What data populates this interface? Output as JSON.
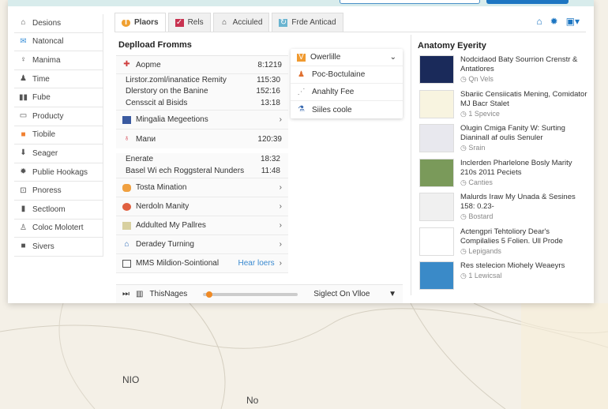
{
  "sidebar": {
    "items": [
      {
        "label": "Desions",
        "icon": "building-icon"
      },
      {
        "label": "Natoncal",
        "icon": "mail-icon"
      },
      {
        "label": "Manima",
        "icon": "bulb-icon"
      },
      {
        "label": "Time",
        "icon": "user-icon"
      },
      {
        "label": "Fube",
        "icon": "columns-icon"
      },
      {
        "label": "Producty",
        "icon": "monitor-icon"
      },
      {
        "label": "Tiobile",
        "icon": "folder-icon"
      },
      {
        "label": "Seager",
        "icon": "download-icon"
      },
      {
        "label": "Publie Hookags",
        "icon": "gear-icon"
      },
      {
        "label": "Pnoress",
        "icon": "terminal-icon"
      },
      {
        "label": "Sectloom",
        "icon": "book-icon"
      },
      {
        "label": "Coloc Molotert",
        "icon": "flask-icon"
      },
      {
        "label": "Sivers",
        "icon": "briefcase-icon"
      }
    ]
  },
  "tabs": [
    {
      "label": "Plaors",
      "active": true
    },
    {
      "label": "Rels"
    },
    {
      "label": "Acciuled"
    },
    {
      "label": "Frde Anticad"
    }
  ],
  "header_icons": [
    "home-icon",
    "gear-icon",
    "user-dropdown-icon"
  ],
  "main": {
    "title": "Deplload Fromms",
    "group1": {
      "label": "Aopme",
      "value": "8:1219",
      "subs": [
        {
          "label": "Lirstor.zoml/inanatice Remity",
          "value": "115:30"
        },
        {
          "label": "Dlerstory on the Banine",
          "value": "152:16"
        },
        {
          "label": "Censscit al Bisids",
          "value": "13:18"
        }
      ]
    },
    "row2": "Mingalia Megeetions",
    "group2": {
      "label": "Manи",
      "value": "120:39",
      "subs": [
        {
          "label": "Enerate",
          "value": "18:32"
        },
        {
          "label": "Basel Wi ech Roggsteral Nunders",
          "value": "11:48"
        }
      ]
    },
    "rows": [
      "Tosta Mination",
      "Nerdoln Manity",
      "Addulted My Pallres",
      "Deradey Turning"
    ],
    "last": {
      "label": "MMS Mildion-Sointional",
      "link": "Hear loers"
    }
  },
  "dropdown": {
    "selected": "Owerlille",
    "items": [
      "Poc-Boctulaine",
      "Anahlty Fee",
      "Siiles coole"
    ]
  },
  "right": {
    "title": "Anatomy Eyerity",
    "items": [
      {
        "title": "Nodcidaod Baty Sourrion Crenstr & Antatlores",
        "meta": "Qn Vels"
      },
      {
        "title": "Sbariic Censiicatis Mening, Comidator MJ Bacr Stalet",
        "meta": "1 Spevice"
      },
      {
        "title": "Olugin Cmiga Fanity W: Surting Dianinall af oulis Senuler",
        "meta": "Srain"
      },
      {
        "title": "Inclerden Pharlelone Bosly Marity 210s 2011 Peciets",
        "meta": "Canties"
      },
      {
        "title": "Malurds Iraw My Unada & Sesines 158: 0.23-",
        "meta": "Bostard"
      },
      {
        "title": "Actengpri Tehtoliory Dear's Compilalies 5 Folien. Ull Prode",
        "meta": "Lepigands"
      },
      {
        "title": "Res stelecion Miohely Weaeyrs",
        "meta": "1 Lewicsal"
      }
    ]
  },
  "footer": {
    "label": "ThisNages",
    "progress": 0.03,
    "select": "Siglect On Vlloe"
  },
  "map": {
    "labels": [
      "NIO",
      "No"
    ]
  }
}
